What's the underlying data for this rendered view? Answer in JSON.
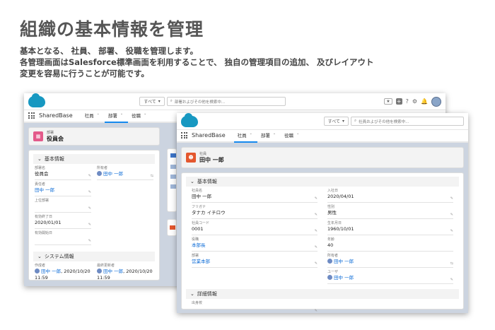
{
  "headline": "組織の基本情報を管理",
  "description": [
    "基本となる、 社員、 部署、 役職を管理します。",
    "各管理画面はSalesforce標準画面を利用することで、 独自の管理項目の追加、 及びレイアウト",
    "変更を容易に行うことが可能です。"
  ],
  "header": {
    "scope": "すべて",
    "search_placeholder_dept": "部署およびその他を検索中...",
    "search_placeholder_emp": "社員およびその他を検索中...",
    "app_name": "SharedBase",
    "tabs": [
      "社員",
      "部署",
      "役職"
    ],
    "util_fav": "★",
    "util_plus": "+",
    "util_help": "?",
    "util_gear": "⚙",
    "util_bell": "🔔"
  },
  "dept": {
    "object": "部署",
    "name": "役員会",
    "section_basic": "基本情報",
    "section_system": "システム情報",
    "fields": {
      "dept_name_label": "部署名",
      "dept_name": "役員会",
      "owner_label": "所有者",
      "owner": "田中 一郎",
      "manager_label": "責任者",
      "manager": "田中 一郎",
      "parent_label": "上位部署",
      "parent": "",
      "end_label": "有効終了日",
      "end": "2020/01/01",
      "start_label": "有効開始日",
      "start": "",
      "created_label": "作成者",
      "created_by": "田中 一郎",
      "created_at": "2020/10/20",
      "created_time": "11:59",
      "modified_label": "最終更新者",
      "modified_by": "田中 一郎",
      "modified_at": "2020/10/20",
      "modified_time": "11:59"
    }
  },
  "emp": {
    "object": "社員",
    "name": "田中 一郎",
    "section_basic": "基本情報",
    "section_detail": "詳細情報",
    "fields": {
      "emp_name_label": "社員名",
      "emp_name": "田中 一郎",
      "hire_label": "入社日",
      "hire": "2020/04/01",
      "kana_label": "フリガナ",
      "kana": "タナカ イチロウ",
      "gender_label": "性別",
      "gender": "男性",
      "code_label": "社員コード",
      "code": "0001",
      "birth_label": "生年月日",
      "birth": "1960/10/01",
      "title_label": "役職",
      "title": "本部長",
      "age_label": "年齢",
      "age": "40",
      "dept_label": "部署",
      "dept": "営業本部",
      "owner_label": "所有者",
      "owner": "田中 一郎",
      "user_label": "ユーザ",
      "user": "田中 一郎",
      "origin_label": "出身校",
      "origin": ""
    }
  },
  "colors": {
    "brand": "#1798c1",
    "link": "#0a6ad6",
    "dept_icon": "#e35a8a",
    "emp_icon": "#e4572e",
    "backdrop": "#ccd4e0"
  }
}
